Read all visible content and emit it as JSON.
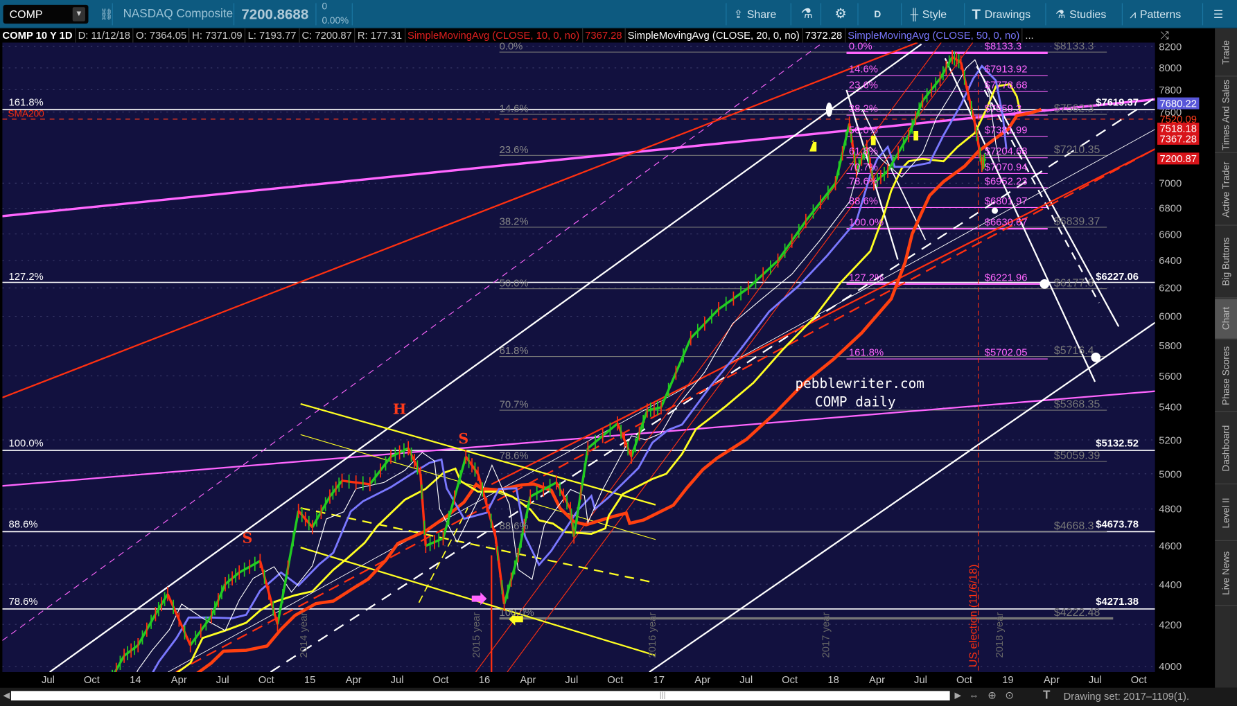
{
  "toolbar": {
    "symbol": "COMP",
    "name": "NASDAQ Composite",
    "last": "7200.8688",
    "change": "0",
    "change_pct": "0.00%",
    "buttons": [
      {
        "label": "Share",
        "icon": "share-icon"
      },
      {
        "label": "",
        "icon": "flask-icon"
      },
      {
        "label": "",
        "icon": "gear-icon"
      },
      {
        "label": "D",
        "icon": ""
      },
      {
        "label": "Style",
        "icon": "candlestick-icon"
      },
      {
        "label": "Drawings",
        "icon": "text-t-icon"
      },
      {
        "label": "Studies",
        "icon": "flask-icon"
      },
      {
        "label": "Patterns",
        "icon": "pattern-icon"
      },
      {
        "label": "",
        "icon": "menu-icon"
      }
    ]
  },
  "infobar": {
    "title": "COMP 10 Y 1D",
    "date": "D: 11/12/18",
    "open": "O: 7364.05",
    "high": "H: 7371.09",
    "low": "L: 7193.77",
    "close": "C: 7200.87",
    "range": "R: 177.31",
    "studies": [
      {
        "label": "SimpleMovingAvg (CLOSE, 10, 0, no)",
        "value": "7367.28",
        "color": "#e02020"
      },
      {
        "label": "SimpleMovingAvg (CLOSE, 20, 0, no)",
        "value": "7372.28",
        "color": "#ffffff"
      },
      {
        "label": "SimpleMovingAvg (CLOSE, 50, 0, no)",
        "value": "...",
        "color": "#7a78ff"
      }
    ]
  },
  "price_axis": {
    "ticks": [
      "8200",
      "8000",
      "7800",
      "7600",
      "7000",
      "6800",
      "6600",
      "6400",
      "6200",
      "6000",
      "5800",
      "5600",
      "5400",
      "5200",
      "5000",
      "4800",
      "4600",
      "4400",
      "4200",
      "4000"
    ],
    "tick_values": [
      8200,
      8000,
      7800,
      7600,
      7000,
      6800,
      6600,
      6400,
      6200,
      6000,
      5800,
      5600,
      5400,
      5200,
      5000,
      4800,
      4600,
      4400,
      4200,
      4000
    ],
    "labels": [
      {
        "text": "7680.22",
        "value": 7680.22,
        "bg": "#5856d8",
        "fg": "#fff"
      },
      {
        "text": "7520.09",
        "value": 7540,
        "bg": "",
        "fg": "#ff3b1a"
      },
      {
        "text": "7518.18",
        "value": 7460,
        "bg": "#d8141a",
        "fg": "#fff"
      },
      {
        "text": "7367.28",
        "value": 7367.28,
        "bg": "#d8141a",
        "fg": "#fff"
      },
      {
        "text": "7200.87",
        "value": 7200.87,
        "bg": "#d8141a",
        "fg": "#fff"
      }
    ]
  },
  "time_axis": [
    "Jul",
    "Oct",
    "14",
    "Apr",
    "Jul",
    "Oct",
    "15",
    "Apr",
    "Jul",
    "Oct",
    "16",
    "Apr",
    "Jul",
    "Oct",
    "17",
    "Apr",
    "Jul",
    "Oct",
    "18",
    "Apr",
    "Jul",
    "Oct",
    "19",
    "Apr",
    "Jul",
    "Oct"
  ],
  "sidebar": [
    {
      "label": "Trade",
      "active": false
    },
    {
      "label": "Times And Sales",
      "active": false
    },
    {
      "label": "Active Trader",
      "active": false
    },
    {
      "label": "Big Buttons",
      "active": false
    },
    {
      "label": "Chart",
      "active": true
    },
    {
      "label": "Phase Scores",
      "active": false
    },
    {
      "label": "Dashboard",
      "active": false
    },
    {
      "label": "Level II",
      "active": false
    },
    {
      "label": "Live News",
      "active": false
    }
  ],
  "chart": {
    "sma200_label": "SMA200",
    "fib_left": [
      "161.8%",
      "127.2%",
      "100.0%",
      "88.6%",
      "78.6%"
    ],
    "fib_left_values": [
      "$7619.37",
      "$6227.06",
      "$5132.52",
      "$4673.78",
      "$4271.38"
    ],
    "fib_mid": [
      "0.0%",
      "14.6%",
      "23.6%",
      "38.2%",
      "50.0%",
      "61.8%",
      "70.7%",
      "78.6%",
      "88.6%",
      "100.0%"
    ],
    "fib_mid_values": [
      "$8133.3",
      "$7562.3",
      "$7210.35",
      "$6839.37",
      "$6177.8",
      "$5716.4",
      "$5368.35",
      "$5059.39",
      "$4668.3",
      "$4222.48"
    ],
    "fib_pink": [
      "0.0%",
      "14.6%",
      "23.6%",
      "38.2%",
      "50.0%",
      "61.8%",
      "70.7%",
      "78.6%",
      "88.6%",
      "100.0%",
      "127.2%",
      "161.8%"
    ],
    "fib_pink_values": [
      "$8133.3",
      "$7913.92",
      "$7778.68",
      "$7559.3",
      "$7381.99",
      "$7204.68",
      "$7070.94",
      "$6952.23",
      "$6801.97",
      "$6630.67",
      "$6221.96",
      "$5702.05"
    ],
    "annotations": [
      "S",
      "H",
      "S",
      "S"
    ],
    "year_labels": [
      "2014 year",
      "2015 year",
      "2016 year",
      "2017 year",
      "2018 year"
    ],
    "election_label": "US election (11/6/18)",
    "watermark": [
      "pebblewriter.com",
      "COMP daily"
    ]
  },
  "price_series": {
    "t": [
      2013.72,
      2013.83,
      2013.92,
      2014.0,
      2014.1,
      2014.17,
      2014.3,
      2014.42,
      2014.5,
      2014.58,
      2014.7,
      2014.8,
      2014.92,
      2015.0,
      2015.1,
      2015.17,
      2015.33,
      2015.45,
      2015.55,
      2015.62,
      2015.65,
      2015.75,
      2015.88,
      2015.95,
      2016.05,
      2016.1,
      2016.18,
      2016.25,
      2016.4,
      2016.48,
      2016.5,
      2016.58,
      2016.75,
      2016.83,
      2016.92,
      2017.0,
      2017.17,
      2017.33,
      2017.5,
      2017.67,
      2017.83,
      2018.0,
      2018.08,
      2018.12,
      2018.18,
      2018.22,
      2018.3,
      2018.42,
      2018.5,
      2018.6,
      2018.67,
      2018.72,
      2018.8,
      2018.84,
      2018.86
    ],
    "close": [
      3760,
      3920,
      4050,
      4100,
      4250,
      4350,
      4100,
      4240,
      4400,
      4460,
      4520,
      4200,
      4790,
      4700,
      4870,
      4960,
      4940,
      5100,
      5150,
      5000,
      4600,
      4640,
      5100,
      5000,
      4650,
      4300,
      4550,
      4870,
      4950,
      4800,
      4650,
      5150,
      5300,
      5100,
      5380,
      5400,
      5850,
      6050,
      6200,
      6400,
      6700,
      7000,
      7500,
      7100,
      7300,
      7000,
      7100,
      7400,
      7700,
      7900,
      8100,
      8050,
      7500,
      7150,
      7200
    ]
  },
  "colors": {
    "toolbar": "#0d5a80",
    "chart_bg": "#12113f",
    "up": "#22cc22",
    "down": "#ff3010",
    "sma10": "#e02020",
    "sma20": "#ffffff",
    "sma50": "#7a78ff",
    "sma100": "#ffff22",
    "sma200": "#ff4010",
    "fib_pink": "#ff66ff"
  },
  "scroll": {
    "drawing_set": "Drawing set: 2017–1109(1)."
  }
}
